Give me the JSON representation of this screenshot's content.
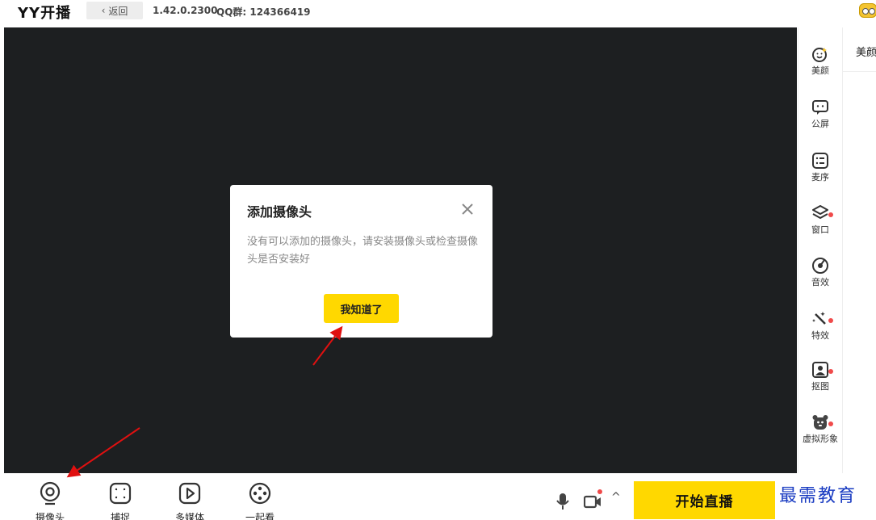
{
  "app": {
    "logo": "YY开播",
    "back_label": "返回",
    "version": "1.42.0.2300",
    "qq_group": "QQ群: 124366419"
  },
  "sidebar": {
    "items": [
      {
        "label": "美颜",
        "icon": "beauty-face-icon",
        "dot": false
      },
      {
        "label": "公屏",
        "icon": "chat-bubble-icon",
        "dot": false
      },
      {
        "label": "麦序",
        "icon": "list-icon",
        "dot": false
      },
      {
        "label": "窗口",
        "icon": "layers-icon",
        "dot": true
      },
      {
        "label": "音效",
        "icon": "sound-disc-icon",
        "dot": false
      },
      {
        "label": "特效",
        "icon": "magic-wand-icon",
        "dot": true
      },
      {
        "label": "抠图",
        "icon": "portrait-cutout-icon",
        "dot": true
      },
      {
        "label": "虚拟形象",
        "icon": "avatar-bear-icon",
        "dot": true
      }
    ]
  },
  "right_panel": {
    "title": "美颜"
  },
  "bottom": {
    "tools": [
      {
        "label": "摄像头",
        "icon": "camera-icon"
      },
      {
        "label": "捕捉",
        "icon": "capture-icon"
      },
      {
        "label": "多媒体",
        "icon": "media-play-icon"
      },
      {
        "label": "一起看",
        "icon": "film-reel-icon"
      }
    ],
    "start_label": "开始直播",
    "watermark": "最需教育"
  },
  "dialog": {
    "title": "添加摄像头",
    "body": "没有可以添加的摄像头，请安装摄像头或检查摄像头是否安装好",
    "ok_label": "我知道了"
  },
  "colors": {
    "accent": "#ffd800",
    "preview_bg": "#1d1f21",
    "alert_dot": "#f04a4a",
    "arrow": "#e01010",
    "watermark": "#1a3cc2"
  }
}
